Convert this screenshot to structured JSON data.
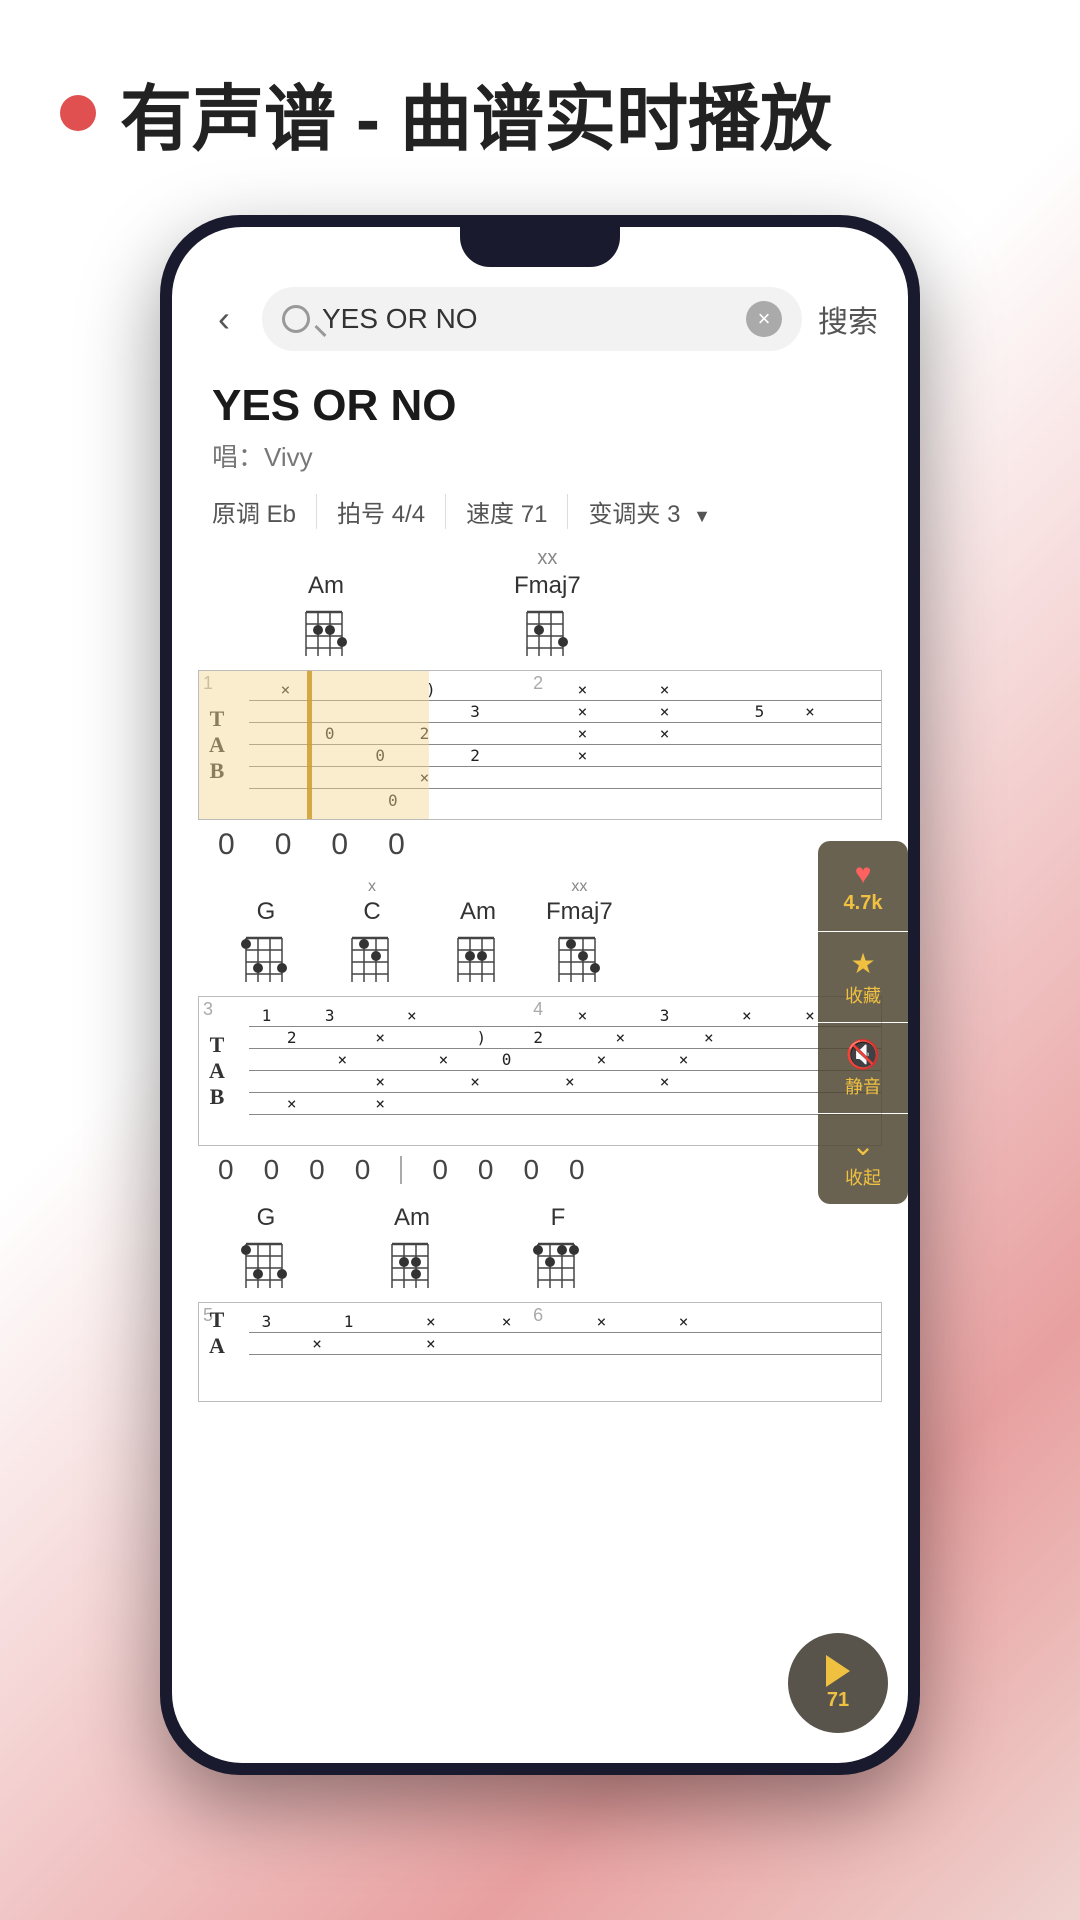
{
  "page": {
    "background": "#fff",
    "header": {
      "dot_color": "#e05050",
      "title": "有声谱 - 曲谱实时播放"
    },
    "phone": {
      "search": {
        "placeholder": "YES OR NO",
        "query": "YES OR NO",
        "search_label": "搜索"
      },
      "song": {
        "title": "YES OR NO",
        "artist": "唱：Vivy",
        "key": "原调 Eb",
        "beat": "拍号 4/4",
        "tempo": "速度 71",
        "capo": "变调夹 3"
      },
      "actions": {
        "like_count": "4.7k",
        "like_label": "❤",
        "collect_label": "收藏",
        "mute_label": "静音",
        "collapse_label": "收起"
      },
      "play": {
        "speed": "71"
      },
      "score": {
        "section1": {
          "chords": [
            "Am",
            "Fmaj7"
          ],
          "numbers": [
            "0",
            "0",
            "0",
            "0"
          ]
        },
        "section2": {
          "chords": [
            "G",
            "C",
            "Am",
            "Fmaj7"
          ],
          "numbers": [
            "0",
            "0",
            "0",
            "0",
            "0",
            "0",
            "0",
            "0"
          ]
        },
        "section3": {
          "chords": [
            "G",
            "Am",
            "F"
          ],
          "numbers": []
        }
      }
    }
  }
}
